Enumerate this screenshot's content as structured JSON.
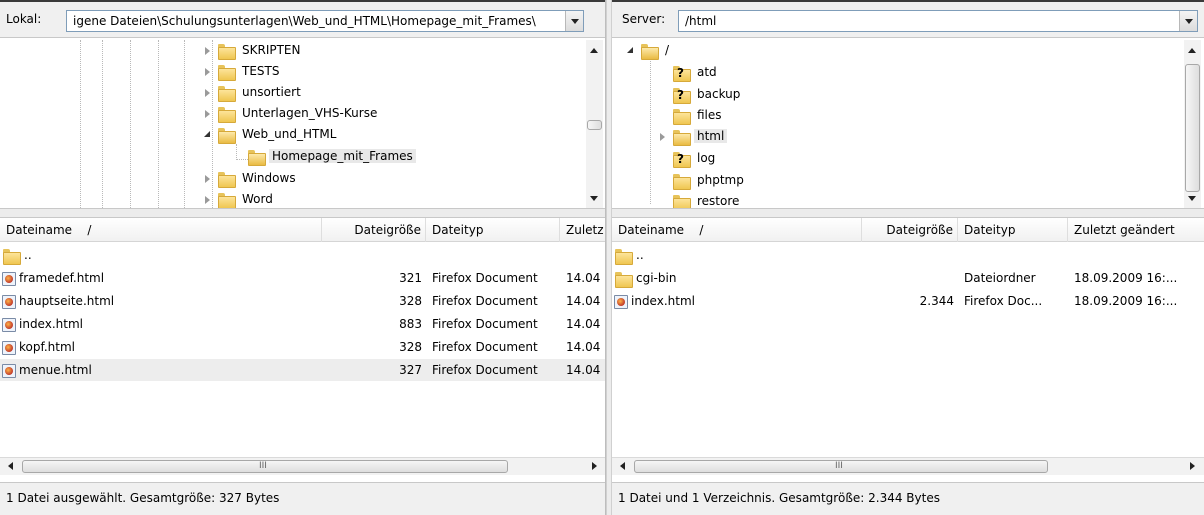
{
  "local": {
    "path_label": "Lokal:",
    "path_value": "igene Dateien\\Schulungsunterlagen\\Web_und_HTML\\Homepage_mit_Frames\\",
    "tree": [
      {
        "label": "SKRIPTEN",
        "state": "closed",
        "level": 0,
        "icon": "folder"
      },
      {
        "label": "TESTS",
        "state": "closed",
        "level": 0,
        "icon": "folder"
      },
      {
        "label": "unsortiert",
        "state": "closed",
        "level": 0,
        "icon": "folder"
      },
      {
        "label": "Unterlagen_VHS-Kurse",
        "state": "closed",
        "level": 0,
        "icon": "folder"
      },
      {
        "label": "Web_und_HTML",
        "state": "open",
        "level": 0,
        "icon": "folder"
      },
      {
        "label": "Homepage_mit_Frames",
        "state": "none",
        "level": 1,
        "icon": "folder-open",
        "selected": true
      },
      {
        "label": "Windows",
        "state": "closed",
        "level": 0,
        "icon": "folder"
      },
      {
        "label": "Word",
        "state": "closed",
        "level": 0,
        "icon": "folder"
      }
    ],
    "columns": [
      "Dateiname",
      "/",
      "Dateigröße",
      "Dateityp",
      "Zuletz"
    ],
    "files": [
      {
        "name": "..",
        "size": "",
        "type": "",
        "modified": "",
        "icon": "folder"
      },
      {
        "name": "framedef.html",
        "size": "321",
        "type": "Firefox Document",
        "modified": "14.04",
        "icon": "firefox-doc-icon"
      },
      {
        "name": "hauptseite.html",
        "size": "328",
        "type": "Firefox Document",
        "modified": "14.04",
        "icon": "firefox-doc-icon"
      },
      {
        "name": "index.html",
        "size": "883",
        "type": "Firefox Document",
        "modified": "14.04",
        "icon": "firefox-doc-icon"
      },
      {
        "name": "kopf.html",
        "size": "328",
        "type": "Firefox Document",
        "modified": "14.04",
        "icon": "firefox-doc-icon"
      },
      {
        "name": "menue.html",
        "size": "327",
        "type": "Firefox Document",
        "modified": "14.04",
        "icon": "firefox-doc-icon",
        "selected": true
      }
    ],
    "hscroll_grip": "III",
    "status": "1 Datei ausgewählt. Gesamtgröße: 327 Bytes"
  },
  "remote": {
    "path_label": "Server:",
    "path_value": "/html",
    "tree": [
      {
        "label": "/",
        "state": "open",
        "level": 0,
        "icon": "folder-open"
      },
      {
        "label": "atd",
        "state": "none",
        "level": 1,
        "icon": "folder-unknown"
      },
      {
        "label": "backup",
        "state": "none",
        "level": 1,
        "icon": "folder-unknown"
      },
      {
        "label": "files",
        "state": "none",
        "level": 1,
        "icon": "folder"
      },
      {
        "label": "html",
        "state": "closed",
        "level": 1,
        "icon": "folder-open",
        "selected": true
      },
      {
        "label": "log",
        "state": "none",
        "level": 1,
        "icon": "folder-unknown"
      },
      {
        "label": "phptmp",
        "state": "none",
        "level": 1,
        "icon": "folder"
      },
      {
        "label": "restore",
        "state": "none",
        "level": 1,
        "icon": "folder"
      }
    ],
    "columns": [
      "Dateiname",
      "/",
      "Dateigröße",
      "Dateityp",
      "Zuletzt geändert"
    ],
    "files": [
      {
        "name": "..",
        "size": "",
        "type": "",
        "modified": "",
        "icon": "folder"
      },
      {
        "name": "cgi-bin",
        "size": "",
        "type": "Dateiordner",
        "modified": "18.09.2009 16:...",
        "icon": "folder"
      },
      {
        "name": "index.html",
        "size": "2.344",
        "type": "Firefox Doc...",
        "modified": "18.09.2009 16:...",
        "icon": "firefox-doc-icon"
      }
    ],
    "hscroll_grip": "III",
    "status": "1 Datei und 1 Verzeichnis. Gesamtgröße: 2.344 Bytes"
  },
  "unknown_marker": "?",
  "colors": {
    "selection": "#e8e8e8",
    "folder": "#efc651",
    "pane_bg": "#f0f0f0"
  }
}
